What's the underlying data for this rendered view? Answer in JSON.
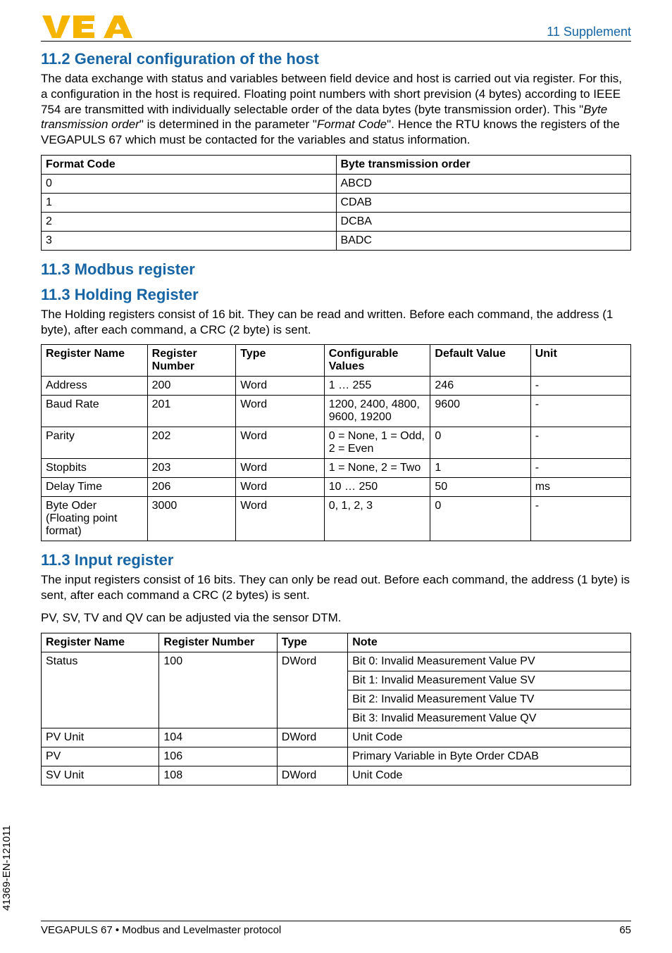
{
  "header": {
    "section_label": "11 Supplement"
  },
  "sections": {
    "s1": {
      "title": "11.2  General configuration of the host",
      "para_a": "The data exchange with status and variables between field device and host is carried out via register. For this, a configuration in the host is required. Floating point numbers with short prevision (4 bytes) according to IEEE 754 are transmitted with individually selectable order of the data bytes (byte transmission order). This \"",
      "para_b_ital": "Byte transmission order",
      "para_c": "\" is determined in the parameter \"",
      "para_d_ital": "Format Code",
      "para_e": "\". Hence the RTU knows the registers of the VEGAPULS 67 which must be contacted for the variables and status information."
    },
    "s2": {
      "title": "11.3  Modbus register"
    },
    "s3": {
      "title": "11.3  Holding Register",
      "para": "The Holding registers consist of 16 bit. They can be read and written. Before each command, the address (1 byte), after each command, a CRC (2 byte) is sent."
    },
    "s4": {
      "title": "11.3  Input register",
      "para1": "The input registers consist of 16 bits. They can only be read out. Before each command, the address (1 byte) is sent, after each command a CRC (2 bytes) is sent.",
      "para2": "PV, SV, TV and QV can be adjusted via the sensor DTM."
    }
  },
  "table1": {
    "headers": [
      "Format Code",
      "Byte transmission order"
    ],
    "rows": [
      [
        "0",
        "ABCD"
      ],
      [
        "1",
        "CDAB"
      ],
      [
        "2",
        "DCBA"
      ],
      [
        "3",
        "BADC"
      ]
    ]
  },
  "table2": {
    "headers": [
      "Register Name",
      "Register Number",
      "Type",
      "Configurable Values",
      "Default Value",
      "Unit"
    ],
    "rows": [
      [
        "Address",
        "200",
        "Word",
        "1 … 255",
        "246",
        "-"
      ],
      [
        "Baud Rate",
        "201",
        "Word",
        "1200, 2400, 4800, 9600, 19200",
        "9600",
        "-"
      ],
      [
        "Parity",
        "202",
        "Word",
        "0 = None, 1 = Odd, 2 = Even",
        "0",
        "-"
      ],
      [
        "Stopbits",
        "203",
        "Word",
        "1 = None, 2 = Two",
        "1",
        "-"
      ],
      [
        "Delay Time",
        "206",
        "Word",
        "10 … 250",
        "50",
        "ms"
      ],
      [
        "Byte Oder (Floating point format)",
        "3000",
        "Word",
        "0, 1, 2, 3",
        "0",
        "-"
      ]
    ]
  },
  "table3": {
    "headers": [
      "Register Name",
      "Register Number",
      "Type",
      "Note"
    ],
    "rows": [
      [
        "Status",
        "100",
        "DWord",
        "Bit 0: Invalid Measurement Value PV"
      ],
      [
        "",
        "",
        "",
        "Bit 1: Invalid Measurement Value SV"
      ],
      [
        "",
        "",
        "",
        "Bit 2: Invalid Measurement Value TV"
      ],
      [
        "",
        "",
        "",
        "Bit 3: Invalid Measurement Value QV"
      ],
      [
        "PV Unit",
        "104",
        "DWord",
        "Unit Code"
      ],
      [
        "PV",
        "106",
        "",
        "Primary Variable in Byte Order CDAB"
      ],
      [
        "SV Unit",
        "108",
        "DWord",
        "Unit Code"
      ]
    ]
  },
  "side_doc_id": "41369-EN-121011",
  "footer": {
    "left": "VEGAPULS 67 • Modbus and Levelmaster protocol",
    "right": "65"
  },
  "chart_data": {
    "type": "table",
    "tables": [
      {
        "title": "Format Code / Byte transmission order",
        "columns": [
          "Format Code",
          "Byte transmission order"
        ],
        "data": [
          [
            0,
            "ABCD"
          ],
          [
            1,
            "CDAB"
          ],
          [
            2,
            "DCBA"
          ],
          [
            3,
            "BADC"
          ]
        ]
      },
      {
        "title": "Holding Register",
        "columns": [
          "Register Name",
          "Register Number",
          "Type",
          "Configurable Values",
          "Default Value",
          "Unit"
        ],
        "data": [
          [
            "Address",
            200,
            "Word",
            "1 … 255",
            246,
            null
          ],
          [
            "Baud Rate",
            201,
            "Word",
            "1200, 2400, 4800, 9600, 19200",
            9600,
            null
          ],
          [
            "Parity",
            202,
            "Word",
            "0 = None, 1 = Odd, 2 = Even",
            0,
            null
          ],
          [
            "Stopbits",
            203,
            "Word",
            "1 = None, 2 = Two",
            1,
            null
          ],
          [
            "Delay Time",
            206,
            "Word",
            "10 … 250",
            50,
            "ms"
          ],
          [
            "Byte Oder (Floating point format)",
            3000,
            "Word",
            "0, 1, 2, 3",
            0,
            null
          ]
        ]
      },
      {
        "title": "Input register",
        "columns": [
          "Register Name",
          "Register Number",
          "Type",
          "Note"
        ],
        "data": [
          [
            "Status",
            100,
            "DWord",
            "Bit 0: Invalid Measurement Value PV; Bit 1: Invalid Measurement Value SV; Bit 2: Invalid Measurement Value TV; Bit 3: Invalid Measurement Value QV"
          ],
          [
            "PV Unit",
            104,
            "DWord",
            "Unit Code"
          ],
          [
            "PV",
            106,
            null,
            "Primary Variable in Byte Order CDAB"
          ],
          [
            "SV Unit",
            108,
            "DWord",
            "Unit Code"
          ]
        ]
      }
    ]
  }
}
